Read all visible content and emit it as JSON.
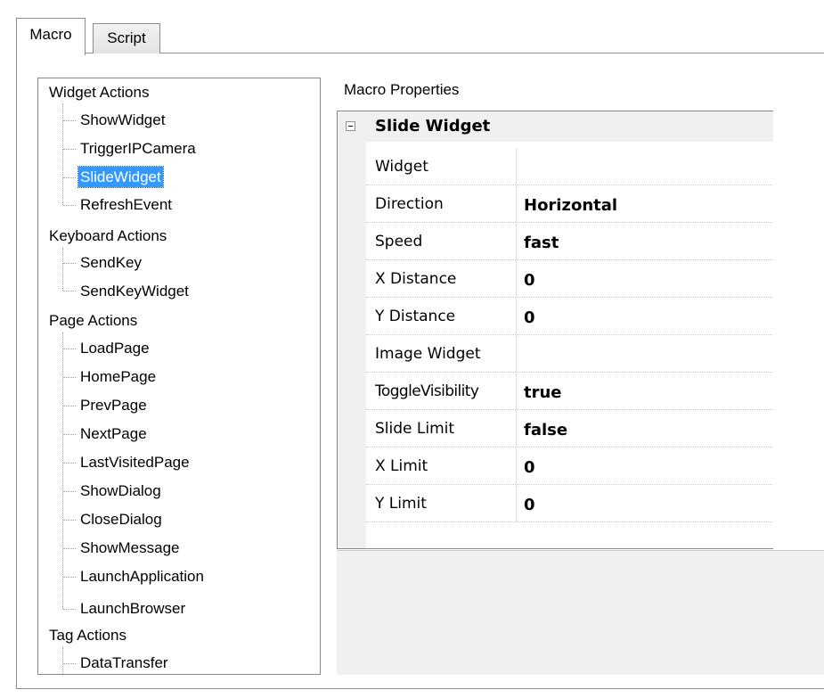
{
  "tabs": [
    {
      "label": "Macro",
      "active": true
    },
    {
      "label": "Script",
      "active": false
    }
  ],
  "tree": {
    "groups": [
      {
        "label": "Widget Actions",
        "items": [
          "ShowWidget",
          "TriggerIPCamera",
          "SlideWidget",
          "RefreshEvent"
        ]
      },
      {
        "label": "Keyboard Actions",
        "items": [
          "SendKey",
          "SendKeyWidget"
        ]
      },
      {
        "label": "Page Actions",
        "items": [
          "LoadPage",
          "HomePage",
          "PrevPage",
          "NextPage",
          "LastVisitedPage",
          "ShowDialog",
          "CloseDialog",
          "ShowMessage",
          "LaunchApplication",
          "LaunchBrowser"
        ]
      },
      {
        "label": "Tag Actions",
        "items": [
          "DataTransfer"
        ]
      }
    ],
    "selected": "SlideWidget"
  },
  "properties": {
    "title": "Macro Properties",
    "category": "Slide Widget",
    "rows": [
      {
        "name": "Widget",
        "value": ""
      },
      {
        "name": "Direction",
        "value": "Horizontal"
      },
      {
        "name": "Speed",
        "value": "fast"
      },
      {
        "name": "X Distance",
        "value": "0"
      },
      {
        "name": "Y Distance",
        "value": "0"
      },
      {
        "name": "Image Widget",
        "value": ""
      },
      {
        "name": "ToggleVisibility",
        "value": "true"
      },
      {
        "name": "Slide Limit",
        "value": "false"
      },
      {
        "name": "X Limit",
        "value": "0"
      },
      {
        "name": "Y Limit",
        "value": "0"
      }
    ]
  },
  "colors": {
    "selection": "#3399ff",
    "panel_bg": "#f0f0f0",
    "border": "#828790"
  }
}
